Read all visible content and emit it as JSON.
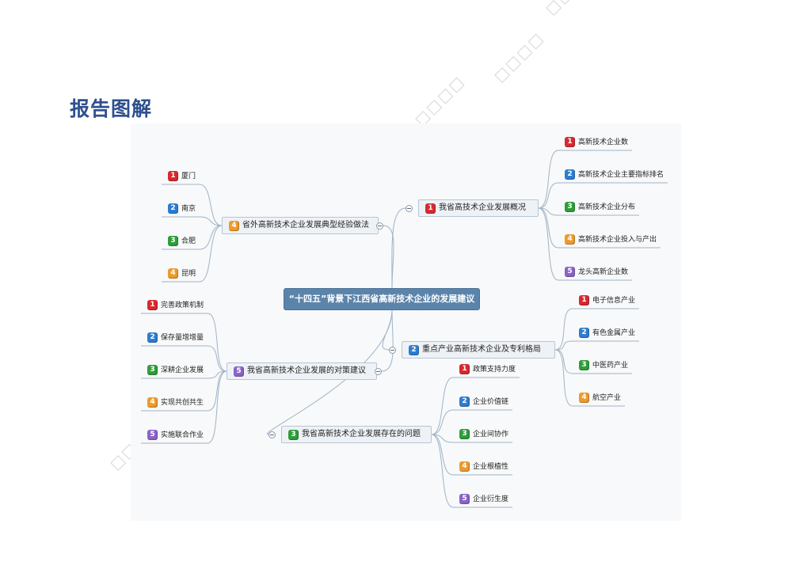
{
  "heading": "报告图解",
  "mindmap": {
    "central": "“十四五”背景下江西省高新技术企业的发展建议",
    "branches": [
      {
        "num": "1",
        "color": "#d8292f",
        "label": "我省高技术企业发展概况",
        "children": [
          {
            "num": "1",
            "color": "#d8292f",
            "label": "高新技术企业数"
          },
          {
            "num": "2",
            "color": "#2e7dd1",
            "label": "高新技术企业主要指标排名"
          },
          {
            "num": "3",
            "color": "#2f9e3a",
            "label": "高新技术企业分布"
          },
          {
            "num": "4",
            "color": "#ee9a2d",
            "label": "高新技术企业投入与产出"
          },
          {
            "num": "5",
            "color": "#8b63c8",
            "label": "龙头高新企业数"
          }
        ]
      },
      {
        "num": "2",
        "color": "#2e7dd1",
        "label": "重点产业高新技术企业及专利格局",
        "children": [
          {
            "num": "1",
            "color": "#d8292f",
            "label": "电子信息产业"
          },
          {
            "num": "2",
            "color": "#2e7dd1",
            "label": "有色金属产业"
          },
          {
            "num": "3",
            "color": "#2f9e3a",
            "label": "中医药产业"
          },
          {
            "num": "4",
            "color": "#ee9a2d",
            "label": "航空产业"
          }
        ]
      },
      {
        "num": "3",
        "color": "#2f9e3a",
        "label": "我省高新技术企业发展存在的问题",
        "children": [
          {
            "num": "1",
            "color": "#d8292f",
            "label": "政策支持力度"
          },
          {
            "num": "2",
            "color": "#2e7dd1",
            "label": "企业价值链"
          },
          {
            "num": "3",
            "color": "#2f9e3a",
            "label": "企业间协作"
          },
          {
            "num": "4",
            "color": "#ee9a2d",
            "label": "企业根植性"
          },
          {
            "num": "5",
            "color": "#8b63c8",
            "label": "企业衍生度"
          }
        ]
      },
      {
        "num": "4",
        "color": "#ee9a2d",
        "label": "省外高新技术企业发展典型经验做法",
        "children": [
          {
            "num": "1",
            "color": "#d8292f",
            "label": "厦门"
          },
          {
            "num": "2",
            "color": "#2e7dd1",
            "label": "南京"
          },
          {
            "num": "3",
            "color": "#2f9e3a",
            "label": "合肥"
          },
          {
            "num": "4",
            "color": "#ee9a2d",
            "label": "昆明"
          }
        ]
      },
      {
        "num": "5",
        "color": "#8b63c8",
        "label": "我省高新技术企业发展的对策建议",
        "children": [
          {
            "num": "1",
            "color": "#d8292f",
            "label": "完善政策机制"
          },
          {
            "num": "2",
            "color": "#2e7dd1",
            "label": "保存量增增量"
          },
          {
            "num": "3",
            "color": "#2f9e3a",
            "label": "深耕企业发展"
          },
          {
            "num": "4",
            "color": "#ee9a2d",
            "label": "实现共创共生"
          },
          {
            "num": "5",
            "color": "#8b63c8",
            "label": "实施联合作业"
          }
        ]
      }
    ]
  }
}
